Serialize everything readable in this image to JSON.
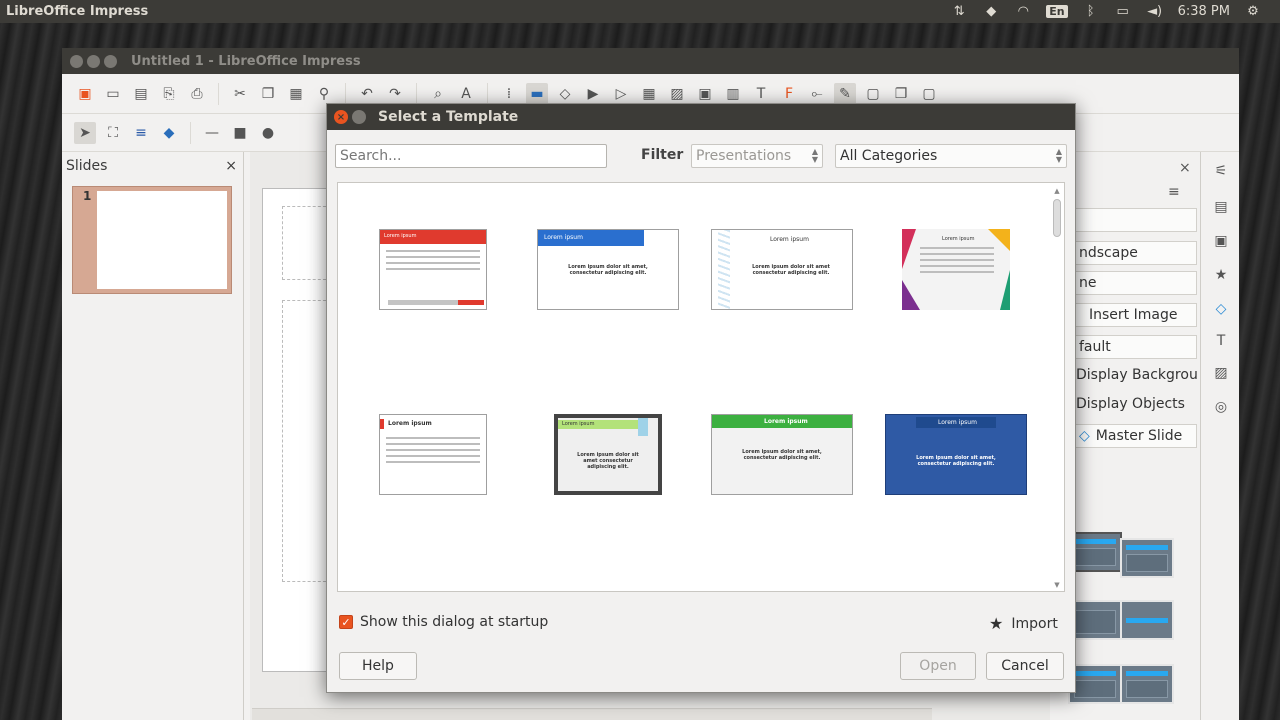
{
  "top_panel": {
    "app_name": "LibreOffice Impress",
    "input_language": "En",
    "clock": "6:38 PM"
  },
  "window": {
    "title": "Untitled 1 - LibreOffice Impress"
  },
  "slides_pane": {
    "title": "Slides",
    "close_glyph": "×",
    "slide_number": "1"
  },
  "sidebar": {
    "close_glyph": "×",
    "menu_glyph": "≡",
    "format_partial": "ndscape",
    "background_partial": "ne",
    "insert_image": "Insert Image",
    "master_partial": "fault",
    "display_background": "Display Backgrou",
    "display_objects": "Display Objects",
    "master_slide": "Master Slide"
  },
  "dialog": {
    "title": "Select a Template",
    "search_placeholder": "Search...",
    "filter_label": "Filter",
    "filter_value": "Presentations",
    "category_value": "All Categories",
    "templates": [
      {
        "title": "Lorem ipsum",
        "body": ""
      },
      {
        "title": "Lorem ipsum",
        "body": "Lorem ipsum dolor sit amet, consectetur adipiscing elit."
      },
      {
        "title": "Lorem ipsum",
        "body": "Lorem ipsum dolor sit amet consectetur adipiscing elit."
      },
      {
        "title": "Lorem ipsum",
        "body": ""
      },
      {
        "title": "Lorem ipsum",
        "body": ""
      },
      {
        "title": "Lorem ipsum",
        "body": "Lorem ipsum dolor sit amet consectetur adipiscing elit."
      },
      {
        "title": "Lorem ipsum",
        "body": "Lorem ipsum dolor sit amet, consectetur adipiscing elit."
      },
      {
        "title": "Lorem ipsum",
        "body": "Lorem ipsum dolor sit amet, consectetur adipiscing elit."
      }
    ],
    "show_at_startup_label": "Show this dialog at startup",
    "show_at_startup_checked": true,
    "import_label": "Import",
    "help_label": "Help",
    "open_label": "Open",
    "cancel_label": "Cancel"
  },
  "colors": {
    "accent": "#e95420",
    "panel": "#3c3b37"
  }
}
